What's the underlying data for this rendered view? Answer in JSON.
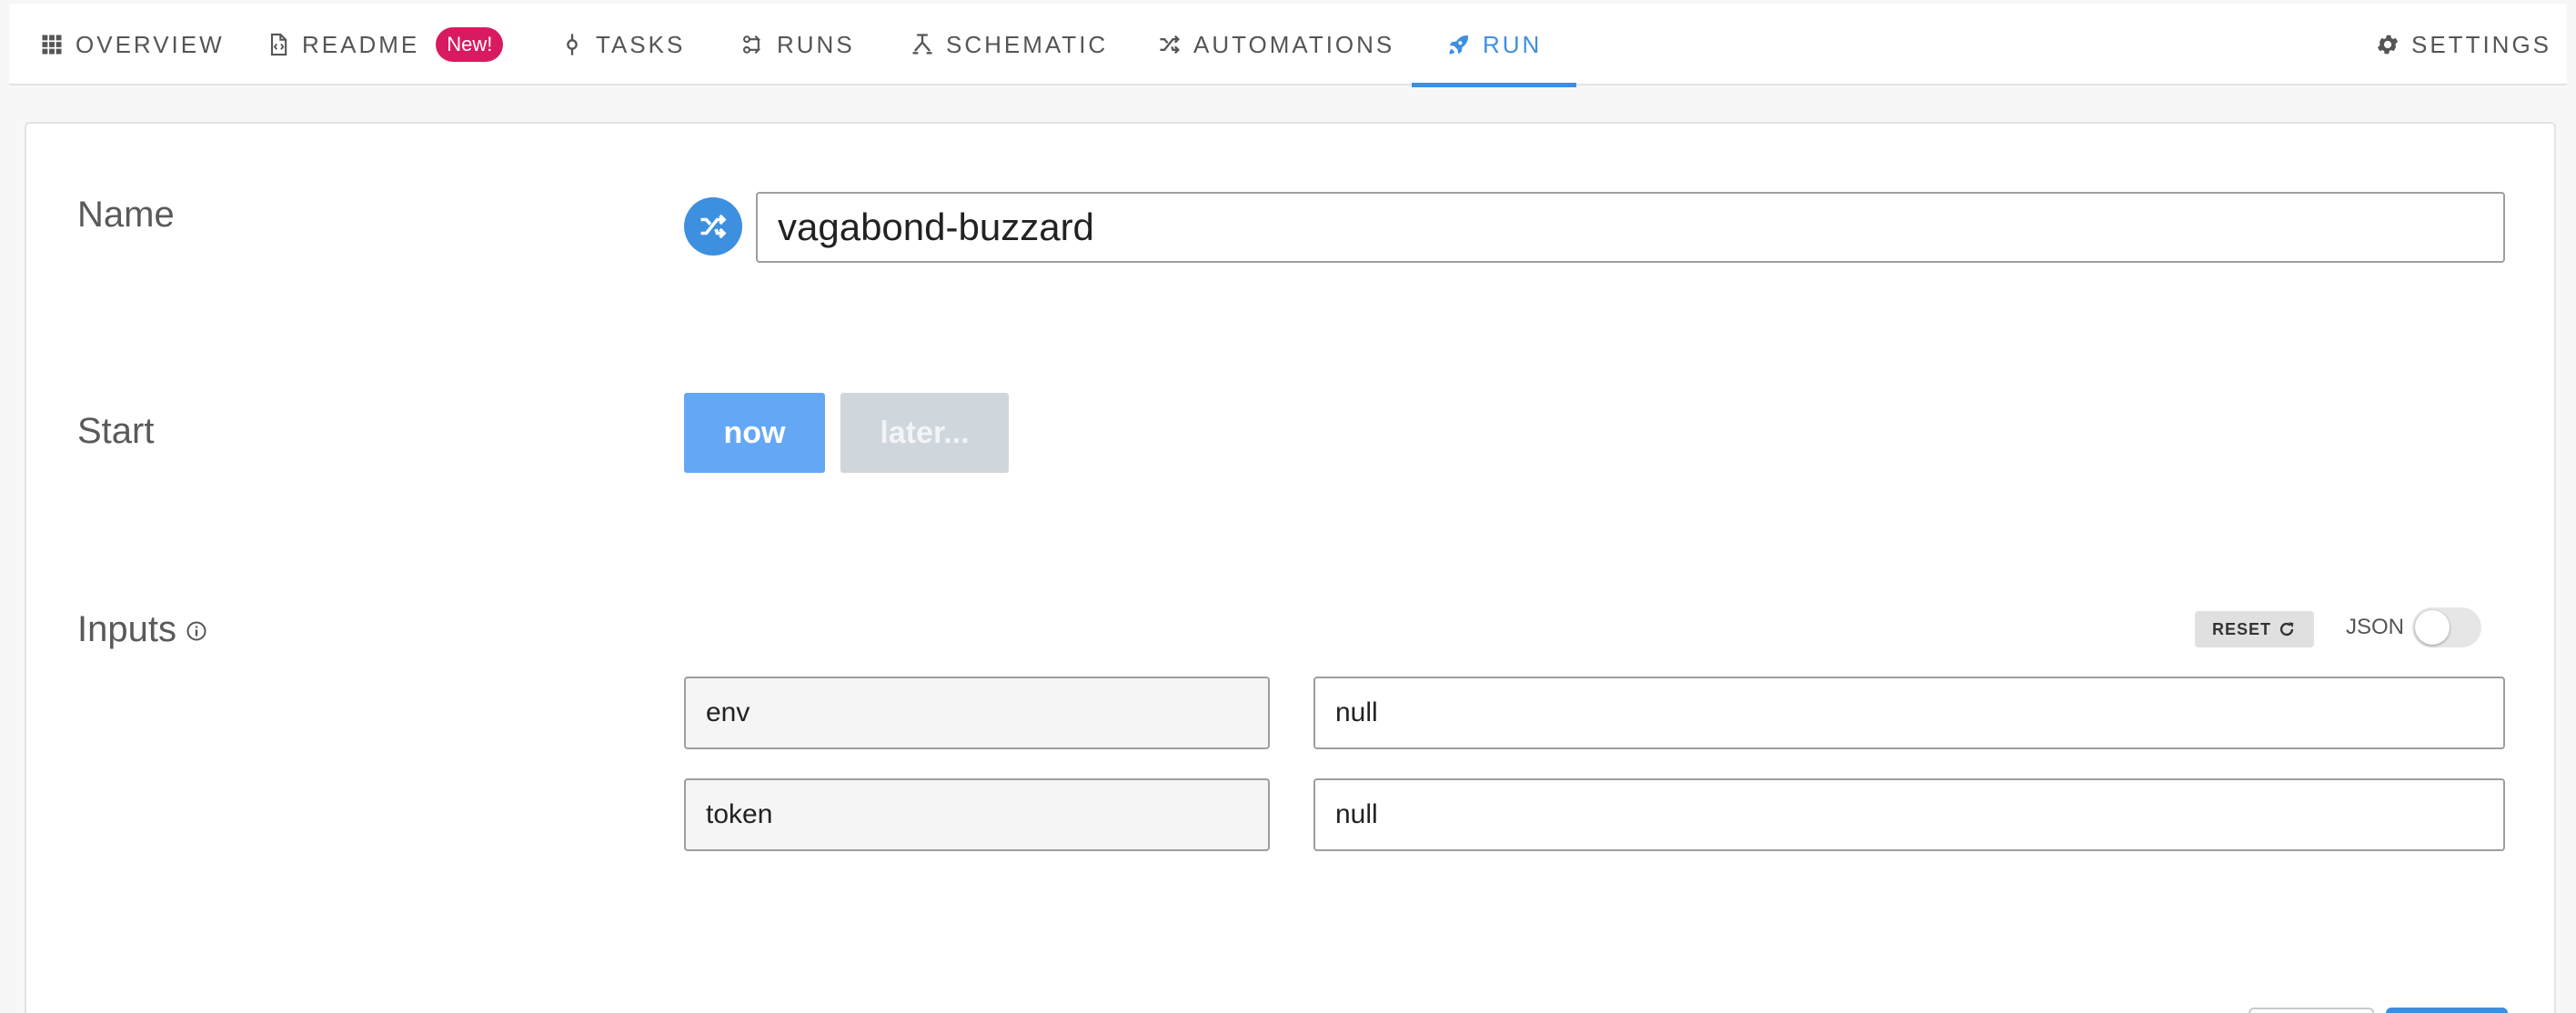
{
  "nav": {
    "tabs": [
      {
        "label": "Overview",
        "icon": "grid-icon"
      },
      {
        "label": "Readme",
        "icon": "document-code-icon",
        "badge": "New!"
      },
      {
        "label": "Tasks",
        "icon": "commit-icon"
      },
      {
        "label": "Runs",
        "icon": "runs-icon"
      },
      {
        "label": "Schematic",
        "icon": "schematic-icon"
      },
      {
        "label": "Automations",
        "icon": "shuffle-icon"
      },
      {
        "label": "Run",
        "icon": "rocket-icon",
        "active": true
      }
    ],
    "settings": {
      "label": "Settings",
      "icon": "gear-icon"
    }
  },
  "form": {
    "name": {
      "label": "Name",
      "value": "vagabond-buzzard"
    },
    "start": {
      "label": "Start",
      "now_label": "now",
      "later_label": "later..."
    },
    "inputs": {
      "label": "Inputs",
      "reset_label": "RESET",
      "json_label": "JSON",
      "json_enabled": false,
      "rows": [
        {
          "key": "env",
          "value": "null"
        },
        {
          "key": "token",
          "value": "null"
        }
      ]
    }
  },
  "colors": {
    "accent": "#3d8fe0",
    "now_button": "#64a8f5",
    "later_button": "#cfd6dc",
    "badge": "#d81b60"
  }
}
